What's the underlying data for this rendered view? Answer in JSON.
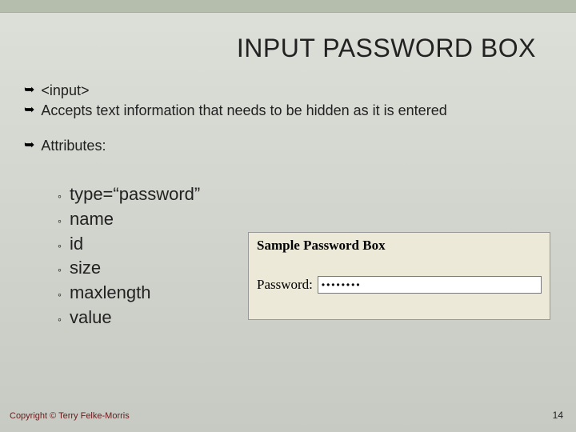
{
  "title": "INPUT PASSWORD BOX",
  "bullets": [
    {
      "glyph": "➥",
      "text": "<input>"
    },
    {
      "glyph": "➥",
      "text": "Accepts text information that needs to be hidden as it is entered"
    }
  ],
  "attributes_heading": {
    "glyph": "➥",
    "text": "Attributes:"
  },
  "attributes": [
    "type=“password”",
    "name",
    "id",
    "size",
    "maxlength",
    "value"
  ],
  "sample": {
    "caption": "Sample Password Box",
    "label": "Password:",
    "value": "••••••••"
  },
  "footer": "Copyright © Terry Felke-Morris",
  "page": "14"
}
